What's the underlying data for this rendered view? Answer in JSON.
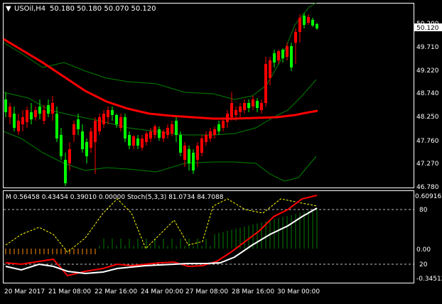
{
  "header": {
    "symbol_label": "USOil,H4",
    "ohlc": "50.180 50.180 50.070 50.120",
    "menu_glyph": "▼"
  },
  "price_scale": {
    "ticks": [
      "50.200",
      "49.710",
      "49.220",
      "48.740",
      "48.250",
      "47.760",
      "47.270",
      "46.780"
    ],
    "current_price": "50.120"
  },
  "oscillator": {
    "label": "M 0.56458 0.43454 0.39010 0.00000  Stoch(5,3,3) 81.0734 84.7088",
    "ticks": [
      "0.60916",
      "80",
      "0.00",
      "20",
      "-0.34512"
    ]
  },
  "time_axis": {
    "labels": [
      "20 Mar 2017",
      "21 Mar 08:00",
      "22 Mar 16:00",
      "24 Mar 00:00",
      "27 Mar 08:00",
      "28 Mar 16:00",
      "30 Mar 00:00"
    ]
  },
  "colors": {
    "background": "#000000",
    "bull": "#00ff00",
    "bear": "#ff0000",
    "bands": "#008000",
    "ma": "#ff0000",
    "stoch_main": "#ffffff",
    "stoch_signal": "#ff0000",
    "macd_pos": "#008000",
    "macd_neg": "#ff8c00",
    "macd_signal": "#ffff00"
  }
}
